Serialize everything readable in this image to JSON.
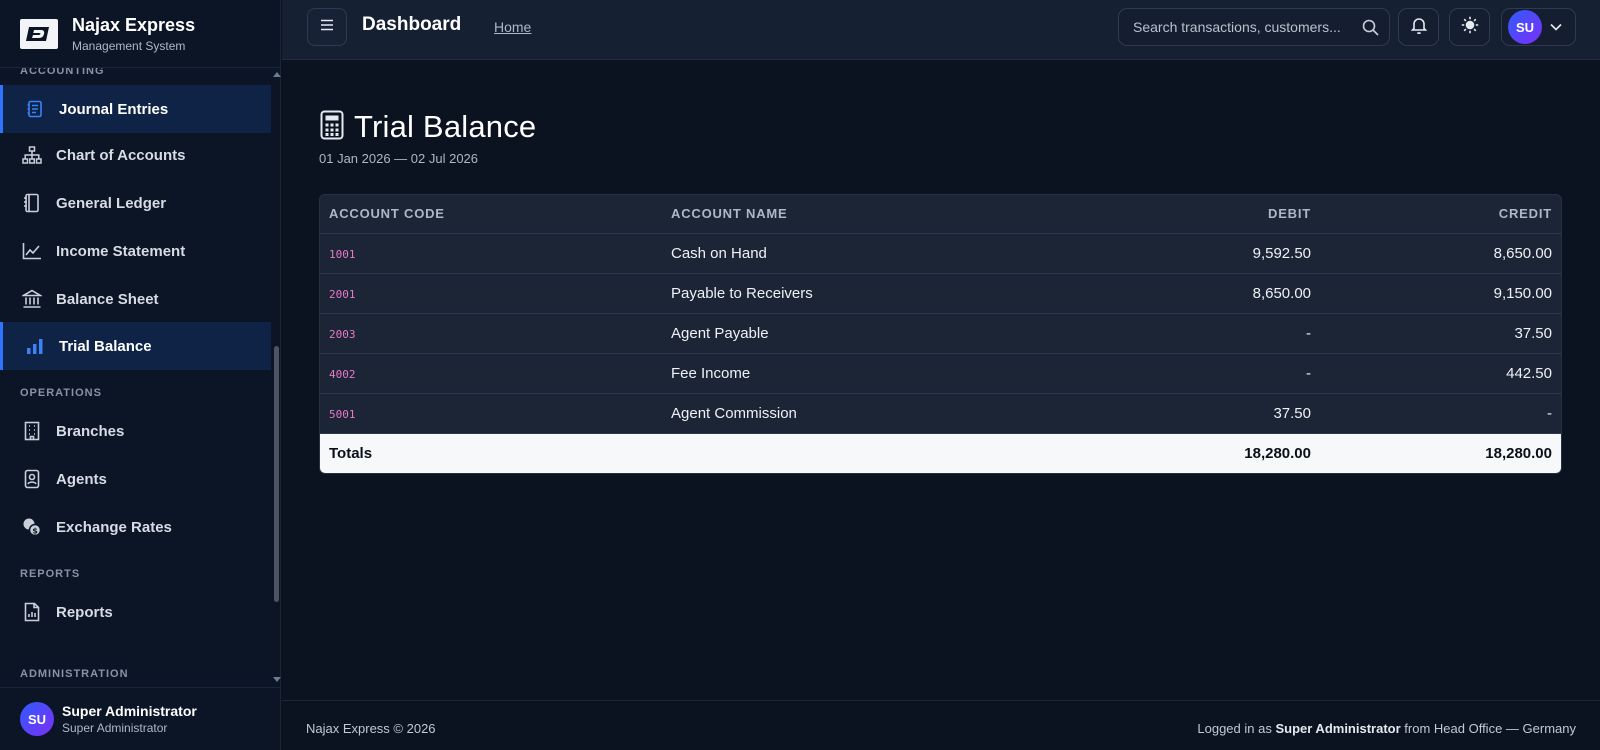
{
  "brand": {
    "name": "Najax Express",
    "subtitle": "Management System"
  },
  "sidebar": {
    "sections": {
      "accounting": "ACCOUNTING",
      "operations": "OPERATIONS",
      "reports": "REPORTS",
      "administration": "ADMINISTRATION"
    },
    "items": [
      {
        "label": "Journal Entries",
        "icon": "journal-icon",
        "active": true
      },
      {
        "label": "Chart of Accounts",
        "icon": "sitemap-icon"
      },
      {
        "label": "General Ledger",
        "icon": "ledger-icon"
      },
      {
        "label": "Income Statement",
        "icon": "line-chart-icon"
      },
      {
        "label": "Balance Sheet",
        "icon": "bank-icon"
      },
      {
        "label": "Trial Balance",
        "icon": "bar-chart-icon",
        "active": true
      },
      {
        "label": "Branches",
        "icon": "building-icon"
      },
      {
        "label": "Agents",
        "icon": "id-badge-icon"
      },
      {
        "label": "Exchange Rates",
        "icon": "coins-icon"
      },
      {
        "label": "Reports",
        "icon": "report-icon"
      }
    ],
    "user": {
      "initials": "SU",
      "name": "Super Administrator",
      "role": "Super Administrator"
    }
  },
  "topbar": {
    "title": "Dashboard",
    "home_link": "Home",
    "search_placeholder": "Search transactions, customers...",
    "profile_initials": "SU"
  },
  "page": {
    "title": "Trial Balance",
    "date_range": "01 Jan 2026 — 02 Jul 2026"
  },
  "table": {
    "headers": [
      "ACCOUNT CODE",
      "ACCOUNT NAME",
      "DEBIT",
      "CREDIT"
    ],
    "rows": [
      {
        "code": "1001",
        "name": "Cash on Hand",
        "debit": "9,592.50",
        "credit": "8,650.00"
      },
      {
        "code": "2001",
        "name": "Payable to Receivers",
        "debit": "8,650.00",
        "credit": "9,150.00"
      },
      {
        "code": "2003",
        "name": "Agent Payable",
        "debit": "-",
        "credit": "37.50"
      },
      {
        "code": "4002",
        "name": "Fee Income",
        "debit": "-",
        "credit": "442.50"
      },
      {
        "code": "5001",
        "name": "Agent Commission",
        "debit": "37.50",
        "credit": "-"
      }
    ],
    "totals": {
      "label": "Totals",
      "debit": "18,280.00",
      "credit": "18,280.00"
    }
  },
  "footer": {
    "left": "Najax Express © 2026",
    "right_prefix": "Logged in as",
    "right_user": "Super Administrator",
    "right_suffix": "from Head Office — Germany"
  },
  "colors": {
    "accent": "#2f74ff",
    "active_bg": "#0e2346",
    "code_text": "#e879c9",
    "page_bg": "#0b1220"
  }
}
